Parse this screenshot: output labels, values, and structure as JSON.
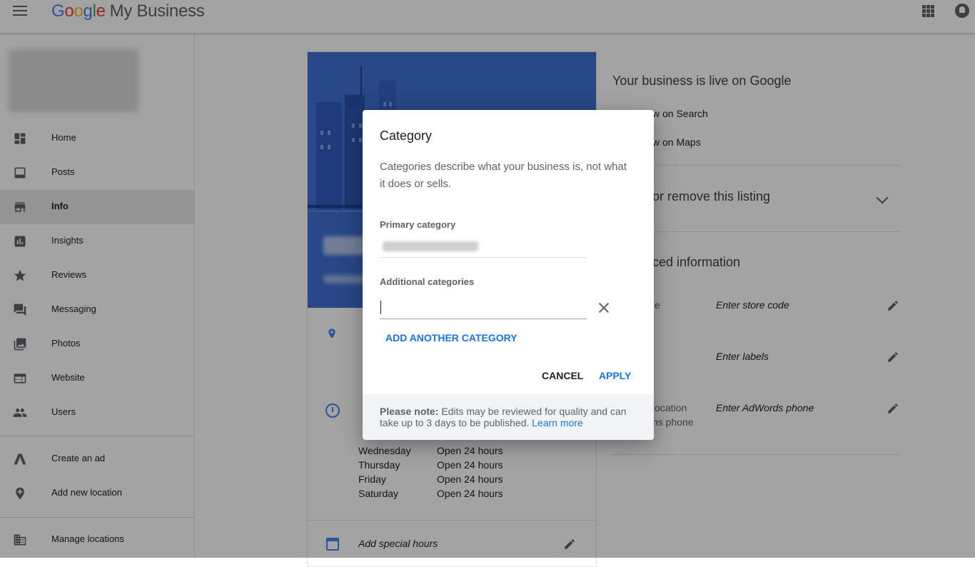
{
  "header": {
    "logo": {
      "G": "G",
      "o1": "o",
      "o2": "o",
      "g": "g",
      "l": "l",
      "e": "e"
    },
    "product": "My Business",
    "icons": [
      "menu-icon",
      "apps-grid-icon",
      "notifications-icon"
    ]
  },
  "sidebar": {
    "items": [
      {
        "label": "Home",
        "icon": "dashboard-icon"
      },
      {
        "label": "Posts",
        "icon": "posts-icon"
      },
      {
        "label": "Info",
        "icon": "storefront-icon",
        "active": true
      },
      {
        "label": "Insights",
        "icon": "insights-icon"
      },
      {
        "label": "Reviews",
        "icon": "star-icon"
      },
      {
        "label": "Messaging",
        "icon": "chat-icon"
      },
      {
        "label": "Photos",
        "icon": "photos-icon"
      },
      {
        "label": "Website",
        "icon": "website-icon"
      },
      {
        "label": "Users",
        "icon": "users-icon"
      }
    ],
    "secondary": [
      {
        "label": "Create an ad",
        "icon": "ads-icon"
      },
      {
        "label": "Add new location",
        "icon": "add-location-icon"
      }
    ],
    "tertiary": [
      {
        "label": "Manage locations",
        "icon": "building-icon"
      }
    ]
  },
  "info_card": {
    "hours": [
      {
        "day": "Wednesday",
        "value": "Open 24 hours"
      },
      {
        "day": "Thursday",
        "value": "Open 24 hours"
      },
      {
        "day": "Friday",
        "value": "Open 24 hours"
      },
      {
        "day": "Saturday",
        "value": "Open 24 hours"
      }
    ],
    "special_hours": "Add special hours"
  },
  "right_panel": {
    "live_title": "Your business is live on Google",
    "view_search": "w on Search",
    "view_maps": "w on Maps",
    "remove_listing": "or remove this listing",
    "advanced_title": "ced information",
    "store_code_label": "le",
    "store_code_value": "Enter store code",
    "labels_value": "Enter labels",
    "adwords_label_1": "location",
    "adwords_label_2": "ns phone",
    "adwords_value": "Enter AdWords phone"
  },
  "dialog": {
    "title": "Category",
    "description": "Categories describe what your business is, not what it does or sells.",
    "primary_label": "Primary category",
    "additional_label": "Additional categories",
    "additional_value": "",
    "add_another": "ADD ANOTHER CATEGORY",
    "cancel": "CANCEL",
    "apply": "APPLY",
    "note_bold": "Please note:",
    "note_text": " Edits may be reviewed for quality and can take up to 3 days to be published. ",
    "note_link": "Learn more"
  }
}
